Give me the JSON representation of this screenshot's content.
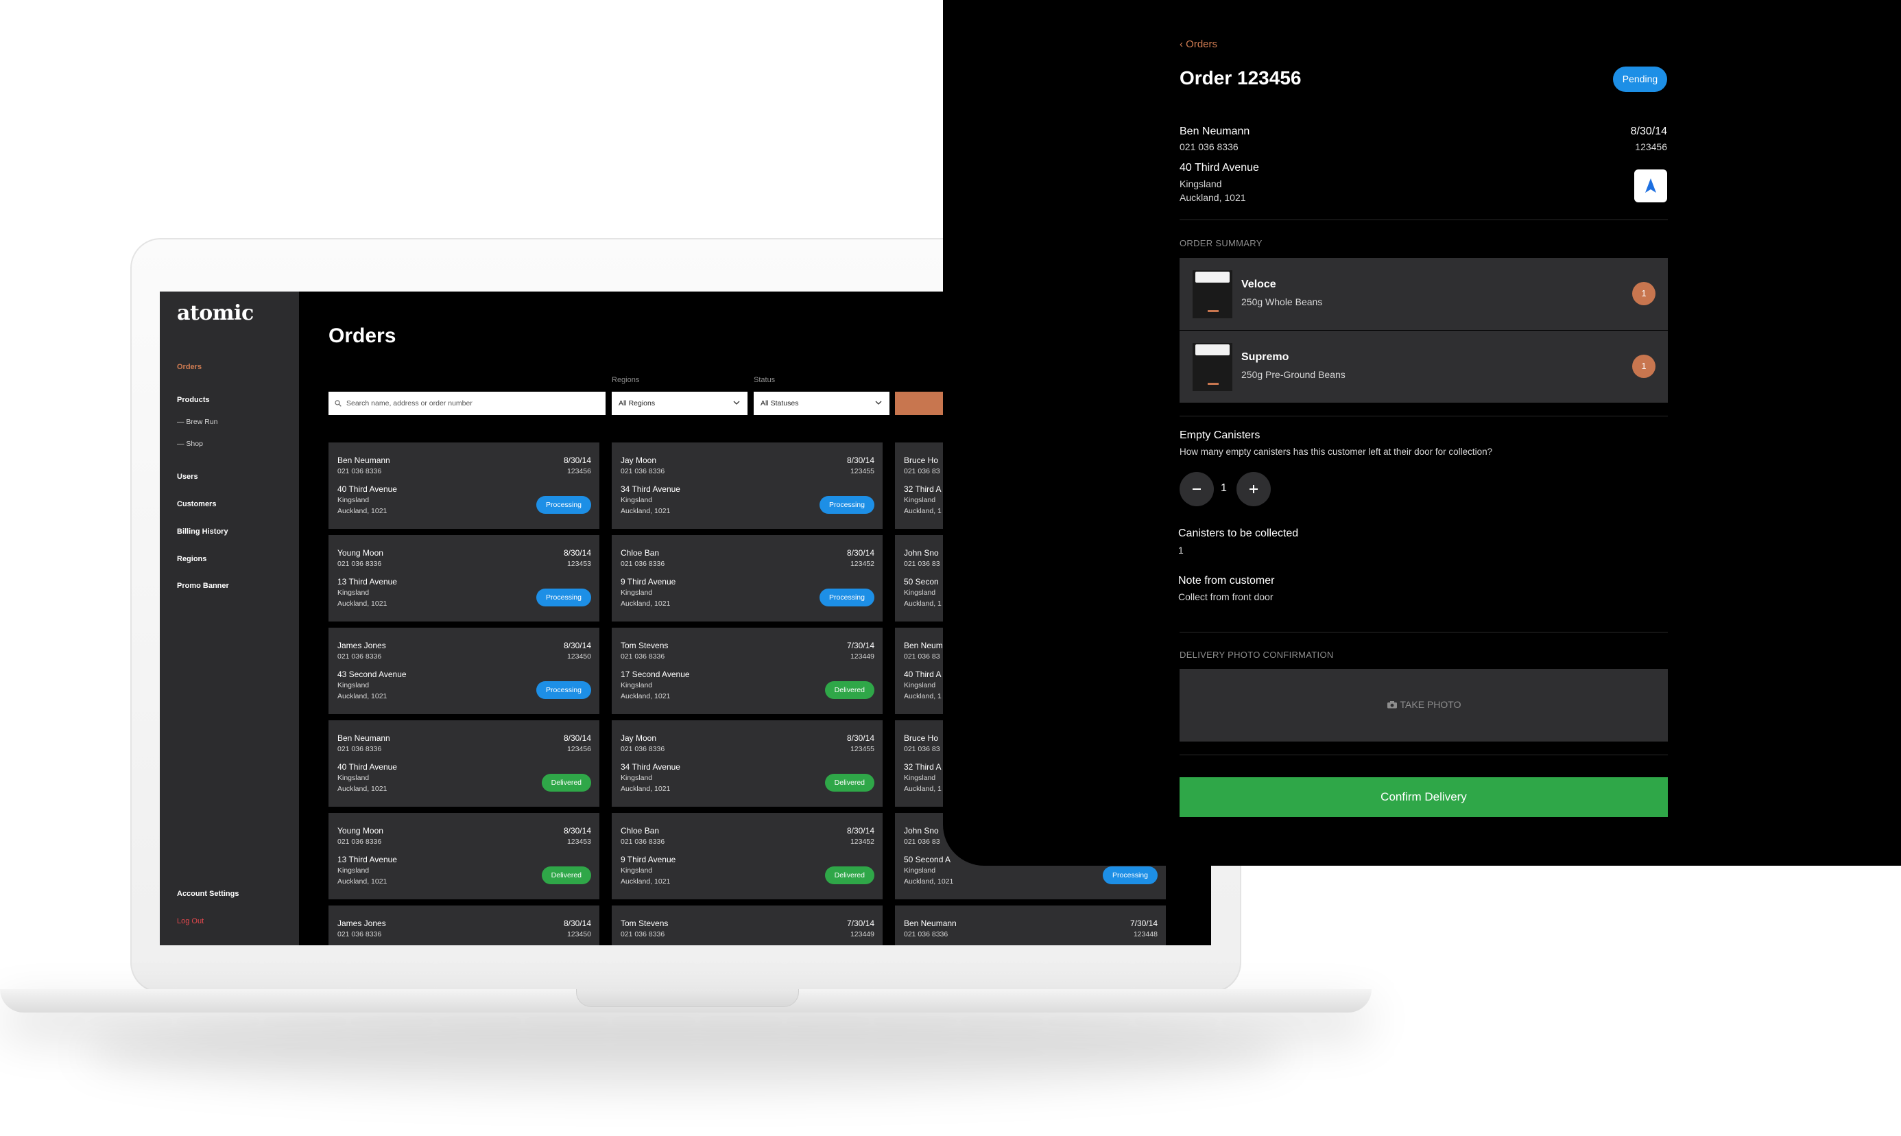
{
  "sidebar": {
    "logo": "atomic",
    "items": [
      "Orders",
      "Products",
      "— Brew Run",
      "— Shop",
      "Users",
      "Customers",
      "Billing History",
      "Regions",
      "Promo Banner"
    ],
    "account_settings": "Account Settings",
    "logout": "Log Out"
  },
  "main": {
    "title": "Orders",
    "search_placeholder": "Search name, address or order number",
    "regions_label": "Regions",
    "regions_value": "All Regions",
    "status_label": "Status",
    "status_value": "All Statuses"
  },
  "orders": [
    {
      "name": "Ben Neumann",
      "phone": "021 036 8336",
      "address": "40 Third Avenue",
      "suburb": "Kingsland",
      "city": "Auckland, 1021",
      "date": "8/30/14",
      "order": "123456",
      "status": "Processing"
    },
    {
      "name": "Jay Moon",
      "phone": "021 036 8336",
      "address": "34 Third Avenue",
      "suburb": "Kingsland",
      "city": "Auckland, 1021",
      "date": "8/30/14",
      "order": "123455",
      "status": "Processing"
    },
    {
      "name": "Bruce Ho",
      "phone": "021 036 83",
      "address": "32 Third A",
      "suburb": "Kingsland",
      "city": "Auckland, 1",
      "date": "",
      "order": "",
      "status": ""
    },
    {
      "name": "Young Moon",
      "phone": "021 036 8336",
      "address": "13 Third Avenue",
      "suburb": "Kingsland",
      "city": "Auckland, 1021",
      "date": "8/30/14",
      "order": "123453",
      "status": "Processing"
    },
    {
      "name": "Chloe Ban",
      "phone": "021 036 8336",
      "address": "9 Third Avenue",
      "suburb": "Kingsland",
      "city": "Auckland, 1021",
      "date": "8/30/14",
      "order": "123452",
      "status": "Processing"
    },
    {
      "name": "John Sno",
      "phone": "021 036 83",
      "address": "50 Secon",
      "suburb": "Kingsland",
      "city": "Auckland, 1",
      "date": "",
      "order": "",
      "status": ""
    },
    {
      "name": "James Jones",
      "phone": "021 036 8336",
      "address": "43 Second Avenue",
      "suburb": "Kingsland",
      "city": "Auckland, 1021",
      "date": "8/30/14",
      "order": "123450",
      "status": "Processing"
    },
    {
      "name": "Tom Stevens",
      "phone": "021 036 8336",
      "address": "17 Second Avenue",
      "suburb": "Kingsland",
      "city": "Auckland, 1021",
      "date": "7/30/14",
      "order": "123449",
      "status": "Delivered"
    },
    {
      "name": "Ben Neum",
      "phone": "021 036 83",
      "address": "40 Third A",
      "suburb": "Kingsland",
      "city": "Auckland, 1",
      "date": "",
      "order": "",
      "status": ""
    },
    {
      "name": "Ben Neumann",
      "phone": "021 036 8336",
      "address": "40 Third Avenue",
      "suburb": "Kingsland",
      "city": "Auckland, 1021",
      "date": "8/30/14",
      "order": "123456",
      "status": "Delivered"
    },
    {
      "name": "Jay Moon",
      "phone": "021 036 8336",
      "address": "34 Third Avenue",
      "suburb": "Kingsland",
      "city": "Auckland, 1021",
      "date": "8/30/14",
      "order": "123455",
      "status": "Delivered"
    },
    {
      "name": "Bruce Ho",
      "phone": "021 036 83",
      "address": "32 Third A",
      "suburb": "Kingsland",
      "city": "Auckland, 1",
      "date": "",
      "order": "",
      "status": ""
    },
    {
      "name": "Young Moon",
      "phone": "021 036 8336",
      "address": "13 Third Avenue",
      "suburb": "Kingsland",
      "city": "Auckland, 1021",
      "date": "8/30/14",
      "order": "123453",
      "status": "Delivered"
    },
    {
      "name": "Chloe Ban",
      "phone": "021 036 8336",
      "address": "9 Third Avenue",
      "suburb": "Kingsland",
      "city": "Auckland, 1021",
      "date": "8/30/14",
      "order": "123452",
      "status": "Delivered"
    },
    {
      "name": "John Sno",
      "phone": "021 036 83",
      "address": "50 Second A",
      "suburb": "Kingsland",
      "city": "Auckland, 1021",
      "date": "",
      "order": "",
      "status": "Processing"
    },
    {
      "name": "James Jones",
      "phone": "021 036 8336",
      "address": "",
      "suburb": "",
      "city": "",
      "date": "8/30/14",
      "order": "123450",
      "status": ""
    },
    {
      "name": "Tom Stevens",
      "phone": "021 036 8336",
      "address": "",
      "suburb": "",
      "city": "",
      "date": "7/30/14",
      "order": "123449",
      "status": ""
    },
    {
      "name": "Ben Neumann",
      "phone": "021 036 8336",
      "address": "",
      "suburb": "",
      "city": "",
      "date": "7/30/14",
      "order": "123448",
      "status": ""
    }
  ],
  "detail": {
    "back": "Orders",
    "title": "Order 123456",
    "status": "Pending",
    "customer_name": "Ben Neumann",
    "customer_phone": "021 036 8336",
    "address": "40 Third Avenue",
    "suburb": "Kingsland",
    "city": "Auckland, 1021",
    "date": "8/30/14",
    "order_number": "123456",
    "order_summary_label": "ORDER SUMMARY",
    "items": [
      {
        "name": "Veloce",
        "desc": "250g Whole Beans",
        "qty": "1"
      },
      {
        "name": "Supremo",
        "desc": "250g Pre-Ground Beans",
        "qty": "1"
      }
    ],
    "empty_canisters_title": "Empty Canisters",
    "empty_canisters_question": "How many empty canisters has this customer left at their door for collection?",
    "stepper_value": "1",
    "collected_label": "Canisters to be collected",
    "collected_value": "1",
    "note_label": "Note from customer",
    "note_value": "Collect from front door",
    "photo_section_label": "DELIVERY PHOTO CONFIRMATION",
    "take_photo": "TAKE PHOTO",
    "confirm": "Confirm Delivery"
  },
  "colors": {
    "accent": "#d07c52",
    "processing": "#1d8fe6",
    "delivered": "#2fa748",
    "panel": "#2f2f31"
  }
}
